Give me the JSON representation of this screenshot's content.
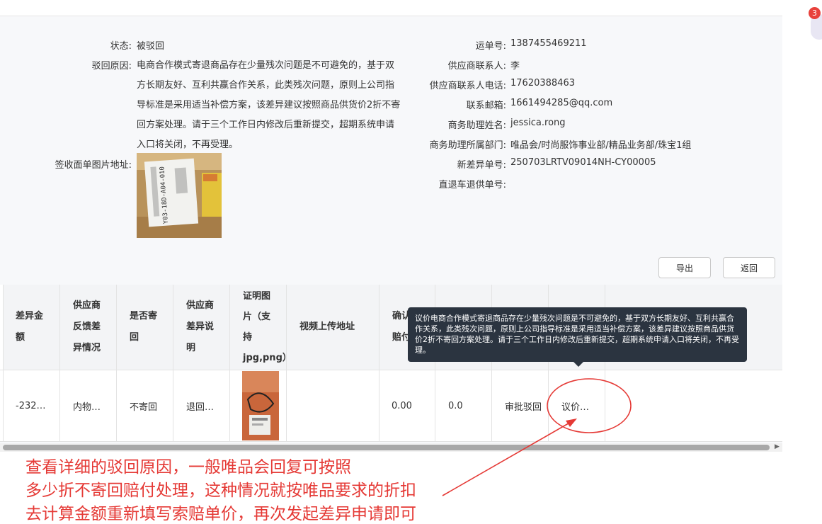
{
  "info_left": {
    "status_label": "状态:",
    "status_value": "被驳回",
    "reason_label": "驳回原因:",
    "reason_value": "电商合作模式寄退商品存在少量残次问题是不可避免的，基于双方长期友好、互利共赢合作关系，此类残次问题，原则上公司指导标准是采用适当补偿方案，该差异建议按照商品供货价2折不寄回方案处理。请于三个工作日内修改后重新提交，超期系统申请入口将关闭，不再受理。",
    "receipt_image_label": "签收面单图片地址:",
    "receipt_image_text": "Y03-18D-A04-010"
  },
  "info_right": [
    {
      "label": "运单号:",
      "value": "1387455469211"
    },
    {
      "label": "供应商联系人:",
      "value": "李"
    },
    {
      "label": "供应商联系人电话:",
      "value": "17620388463"
    },
    {
      "label": "联系邮箱:",
      "value": "1661494285@qq.com"
    },
    {
      "label": "商务助理姓名:",
      "value": "jessica.rong"
    },
    {
      "label": "商务助理所属部门:",
      "value": "唯品会/时尚服饰事业部/精品业务部/珠宝1组"
    },
    {
      "label": "新差异单号:",
      "value": "250703LRTV09014NH-CY00005"
    },
    {
      "label": "直退车退供单号:",
      "value": ""
    }
  ],
  "buttons": {
    "export": "导出",
    "back": "返回"
  },
  "table": {
    "headers": [
      "差异金额",
      "供应商反馈差异情况",
      "是否寄回",
      "供应商差异说明",
      "证明图片（支持jpg,png）",
      "视频上传地址",
      "确认赔付"
    ],
    "row": {
      "amount": "-232…",
      "feedback": "内物…",
      "send_back": "不寄回",
      "explanation": "退回…",
      "video": "",
      "value1": "0.00",
      "value2": "0.0",
      "status": "审批驳回",
      "reason_short": "议价…"
    }
  },
  "tooltip": "议价电商合作模式寄退商品存在少量残次问题是不可避免的，基于双方长期友好、互利共赢合作关系，此类残次问题，原则上公司指导标准是采用适当补偿方案，该差异建议按照商品供货价2折不寄回方案处理。请于三个工作日内修改后重新提交，超期系统申请入口将关闭，不再受理。",
  "annotation": {
    "line1": "查看详细的驳回原因，一般唯品会回复可按照",
    "line2": "多少折不寄回赔付处理，这种情况就按唯品要求的折扣",
    "line3": "去计算金额重新填写索赔单价，再次发起差异申请即可"
  },
  "notification": {
    "count": "3"
  },
  "colors": {
    "annotation_red": "#e53935",
    "tooltip_bg": "#2b3440",
    "badge": "#e8413c"
  }
}
